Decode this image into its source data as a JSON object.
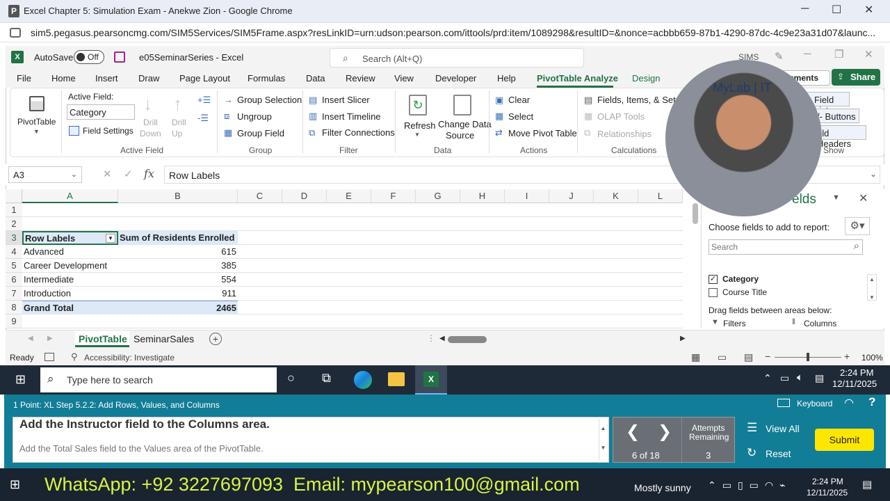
{
  "browser": {
    "tab_title": "Excel Chapter 5: Simulation Exam - Anekwe Zion - Google Chrome",
    "url": "sim5.pegasus.pearsoncmg.com/SIM5Services/SIM5Frame.aspx?resLinkID=urn:udson:pearson.com/ittools/prd:item/1089298&resultID=&nonce=acbbb659-87b1-4290-87dc-4c9e23a31d07&launc...",
    "controls": [
      "─",
      "☐",
      "✕"
    ]
  },
  "excel": {
    "autosave_label": "AutoSave",
    "autosave_state": "Off",
    "file_name": "e05SeminarSeries - Excel",
    "search_placeholder": "Search (Alt+Q)",
    "sims_label": "SIMS",
    "menu": [
      "File",
      "Home",
      "Insert",
      "Draw",
      "Page Layout",
      "Formulas",
      "Data",
      "Review",
      "View",
      "Developer",
      "Help",
      "PivotTable Analyze",
      "Design"
    ],
    "active_menu": "PivotTable Analyze",
    "share_label": "Share",
    "comments_label": "mments",
    "ribbon": {
      "pivottable": "PivotTable",
      "active_field_label": "Active Field:",
      "active_field_value": "Category",
      "field_settings": "Field Settings",
      "drill_down": [
        "Drill",
        "Down"
      ],
      "drill_up": [
        "Drill",
        "Up"
      ],
      "group_active_field": "Active Field",
      "group_selection": "Group Selection",
      "ungroup": "Ungroup",
      "group_field": "Group Field",
      "group_group": "Group",
      "insert_slicer": "Insert Slicer",
      "insert_timeline": "Insert Timeline",
      "filter_connections": "Filter Connections",
      "group_filter": "Filter",
      "refresh": "Refresh",
      "change_data_source": [
        "Change Data",
        "Source"
      ],
      "group_data": "Data",
      "clear": "Clear",
      "select": "Select",
      "move_pivot_table": "Move Pivot Table",
      "group_actions": "Actions",
      "fields_items_sets": "Fields, Items, & Sets",
      "olap_tools": "OLAP Tools",
      "relationships": "Relationships",
      "group_calculations": "Calculations",
      "field_list": "Field List",
      "plus_minus_buttons": "/- Buttons",
      "field_headers": "eld Headers",
      "group_show": "Show"
    },
    "name_box": "A3",
    "formula": "Row Labels",
    "columns": [
      "A",
      "B",
      "C",
      "D",
      "E",
      "F",
      "G",
      "H",
      "I",
      "J",
      "K",
      "L"
    ],
    "rows": [
      "1",
      "2",
      "3",
      "4",
      "5",
      "6",
      "7",
      "8",
      "9"
    ],
    "pivot": {
      "header_left": "Row Labels",
      "header_right": "Sum of Residents Enrolled",
      "rows": [
        {
          "label": "Advanced",
          "value": "615"
        },
        {
          "label": "Career Development",
          "value": "385"
        },
        {
          "label": "Intermediate",
          "value": "554"
        },
        {
          "label": "Introduction",
          "value": "911"
        }
      ],
      "total_label": "Grand Total",
      "total_value": "2465"
    },
    "sheet_tabs": [
      "PivotTable",
      "SeminarSales"
    ],
    "active_sheet": "PivotTable",
    "status_ready": "Ready",
    "accessibility": "Accessibility: Investigate",
    "zoom": "100%",
    "field_pane": {
      "title": "elds",
      "choose": "Choose fields to add to report:",
      "search_placeholder": "Search",
      "fields": [
        {
          "label": "Category",
          "checked": true
        },
        {
          "label": "Course Title",
          "checked": false
        }
      ],
      "drag_label": "Drag fields between areas below:",
      "filters": "Filters",
      "columns": "Columns"
    },
    "webcam_text": "MyLab | IT"
  },
  "taskbar": {
    "search_placeholder": "Type here to search",
    "time": "2:24 PM",
    "date": "12/11/2025"
  },
  "sim": {
    "step": "1 Point: XL Step 5.2.2: Add Rows, Values, and Columns",
    "keyboard": "Keyboard",
    "instruction_main": "Add the Instructor field to the Columns area.",
    "instruction_next": "Add the Total Sales field to the Values area of the PivotTable.",
    "progress": "6 of 18",
    "attempts_label": [
      "Attempts",
      "Remaining"
    ],
    "attempts_value": "3",
    "view_all": "View All",
    "reset": "Reset",
    "submit": "Submit"
  },
  "overlay": {
    "text": "WhatsApp: +92 3227697093  Email: mypearson100@gmail.com",
    "weather": "Mostly sunny",
    "time": "2:24 PM",
    "date": "12/11/2025"
  },
  "colors": {
    "excel_green": "#217346",
    "sim_teal": "#127d96",
    "submit_yellow": "#ffe600",
    "overlay_text": "#d7f542"
  }
}
